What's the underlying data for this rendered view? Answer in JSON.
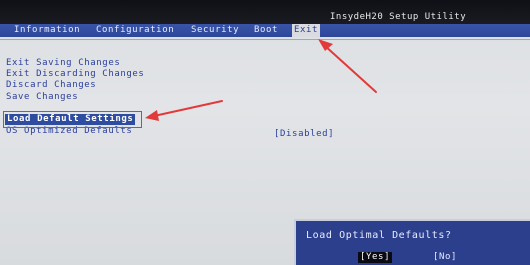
{
  "window": {
    "title": "InsydeH20 Setup Utility"
  },
  "menu": {
    "tabs": [
      {
        "label": "Information"
      },
      {
        "label": "Configuration"
      },
      {
        "label": "Security"
      },
      {
        "label": "Boot"
      },
      {
        "label": "Exit",
        "active": true
      }
    ]
  },
  "exit_menu": {
    "options": [
      {
        "label": "Exit Saving Changes"
      },
      {
        "label": "Exit Discarding Changes"
      },
      {
        "label": "Discard Changes"
      },
      {
        "label": "Save Changes"
      },
      {
        "label": "Load Default Settings",
        "selected": true
      },
      {
        "label": "OS Optimized Defaults",
        "value": "[Disabled]"
      }
    ]
  },
  "dialog": {
    "title": "Load Optimal Defaults?",
    "yes_label": "[Yes]",
    "no_label": "[No]",
    "focused": "yes"
  },
  "colors": {
    "menu_bar": "#2c469a",
    "option_text": "#2b3f9a",
    "annotation": "#e23a3a",
    "dialog_bg": "#2b3f8d"
  }
}
